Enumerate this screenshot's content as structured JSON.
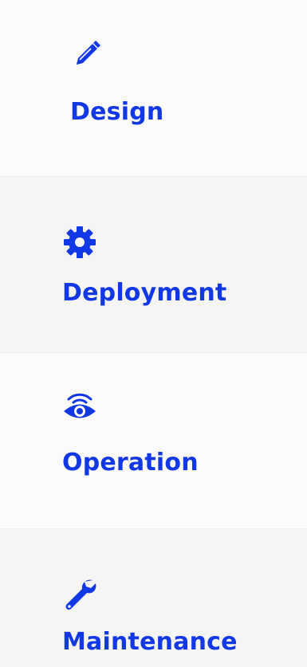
{
  "accent_color": "#1238e6",
  "items": [
    {
      "label": "Design",
      "icon": "pencil-icon"
    },
    {
      "label": "Deployment",
      "icon": "gear-icon"
    },
    {
      "label": "Operation",
      "icon": "eye-broadcast-icon"
    },
    {
      "label": "Maintenance",
      "icon": "wrench-icon"
    }
  ]
}
